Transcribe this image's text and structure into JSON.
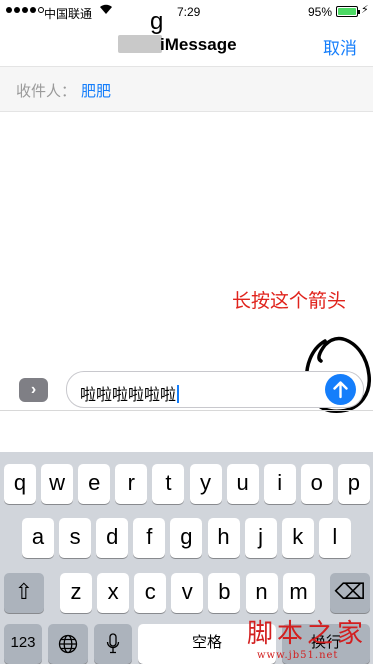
{
  "status_bar": {
    "carrier": "中国联通",
    "time": "7:29",
    "battery_percent": "95%"
  },
  "navbar": {
    "title_top": "g",
    "title": "iMessage",
    "cancel_label": "取消"
  },
  "recipient": {
    "label": "收件人：",
    "name": "肥肥"
  },
  "annotation": "长按这个箭头",
  "compose": {
    "apps_glyph": "›",
    "text": "啦啦啦啦啦啦"
  },
  "keyboard": {
    "row1": [
      "q",
      "w",
      "e",
      "r",
      "t",
      "y",
      "u",
      "i",
      "o",
      "p"
    ],
    "row2": [
      "a",
      "s",
      "d",
      "f",
      "g",
      "h",
      "j",
      "k",
      "l"
    ],
    "row3": [
      "z",
      "x",
      "c",
      "v",
      "b",
      "n",
      "m"
    ],
    "shift_glyph": "⇧",
    "delete_glyph": "⌫",
    "numbers_label": "123",
    "space_label": "空格",
    "return_label": "换行"
  },
  "watermark": {
    "title": "脚本之家",
    "url": "www.jb51.net"
  },
  "colors": {
    "ios_blue": "#157efb",
    "annotation_red": "#e0231c",
    "battery_green": "#4cd964"
  }
}
